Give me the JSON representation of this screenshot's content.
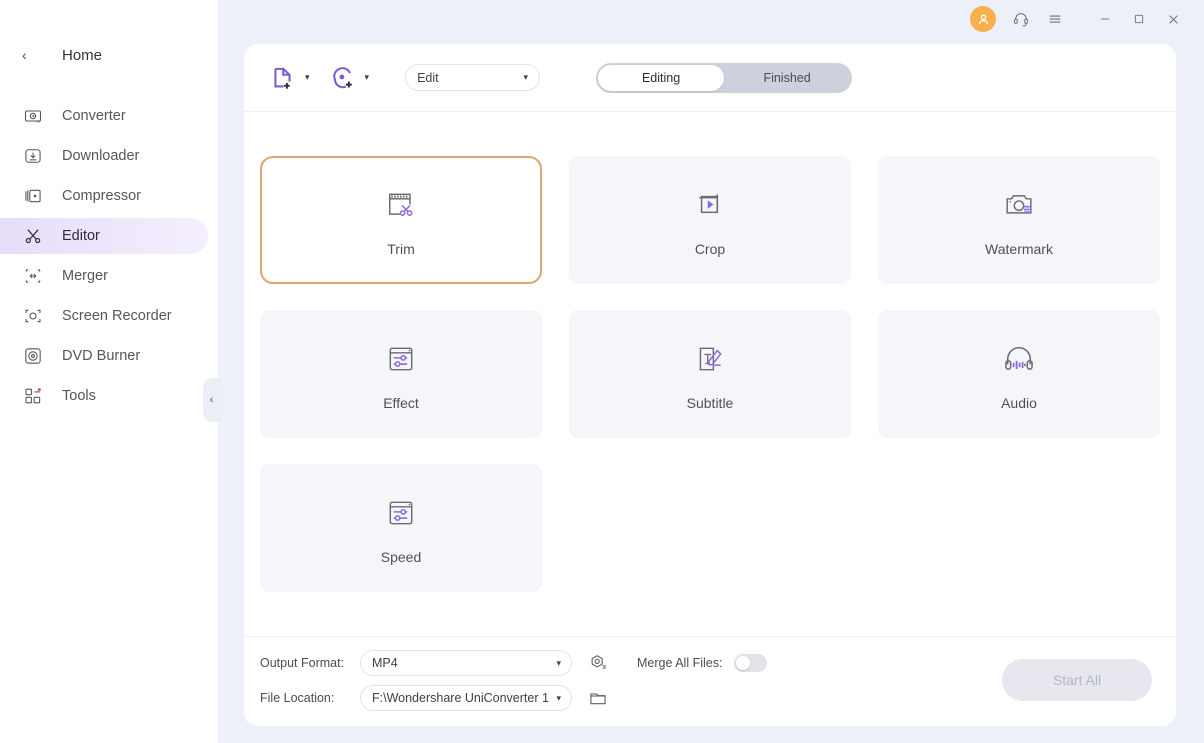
{
  "app": {
    "accent_purple": "#7c5cd6",
    "selected_border": "#d9a970",
    "shell_bg": "#eef0f9"
  },
  "titlebar": {
    "avatar_icon": "user-avatar-icon",
    "support_icon": "headset-support-icon",
    "menu_icon": "hamburger-menu-icon",
    "minimize_icon": "minimize-icon",
    "maximize_icon": "maximize-icon",
    "close_icon": "close-icon"
  },
  "sidebar": {
    "back_chevron": "‹",
    "home_label": "Home",
    "collapse_chevron": "‹",
    "items": [
      {
        "label": "Converter",
        "icon": "converter-icon",
        "active": false
      },
      {
        "label": "Downloader",
        "icon": "downloader-icon",
        "active": false
      },
      {
        "label": "Compressor",
        "icon": "compressor-icon",
        "active": false
      },
      {
        "label": "Editor",
        "icon": "editor-scissors-icon",
        "active": true
      },
      {
        "label": "Merger",
        "icon": "merger-icon",
        "active": false
      },
      {
        "label": "Screen Recorder",
        "icon": "screen-recorder-icon",
        "active": false
      },
      {
        "label": "DVD Burner",
        "icon": "dvd-burner-icon",
        "active": false
      },
      {
        "label": "Tools",
        "icon": "tools-icon",
        "active": false
      }
    ]
  },
  "toolbar": {
    "add_files_icon": "add-file-icon",
    "add_files_caret": "▾",
    "add_dvd_icon": "add-disc-icon",
    "add_dvd_caret": "▾",
    "edit_select_value": "Edit",
    "edit_select_caret": "▾",
    "segment": {
      "editing_label": "Editing",
      "finished_label": "Finished",
      "active": "Editing"
    }
  },
  "cards": [
    {
      "label": "Trim",
      "icon": "trim-scissors-icon",
      "selected": true
    },
    {
      "label": "Crop",
      "icon": "crop-frame-icon",
      "selected": false
    },
    {
      "label": "Watermark",
      "icon": "watermark-camera-icon",
      "selected": false
    },
    {
      "label": "Effect",
      "icon": "effect-sliders-icon",
      "selected": false
    },
    {
      "label": "Subtitle",
      "icon": "subtitle-text-icon",
      "selected": false
    },
    {
      "label": "Audio",
      "icon": "audio-headphone-icon",
      "selected": false
    },
    {
      "label": "Speed",
      "icon": "speed-sliders-icon",
      "selected": false
    }
  ],
  "bottom": {
    "output_format_label": "Output Format:",
    "output_format_value": "MP4",
    "output_format_caret": "▾",
    "settings_icon": "output-settings-icon",
    "file_location_label": "File Location:",
    "file_location_value": "F:\\Wondershare UniConverter 1",
    "file_location_caret": "▾",
    "folder_icon": "folder-open-icon",
    "merge_label": "Merge All Files:",
    "merge_toggle_on": false,
    "start_all_label": "Start All"
  }
}
